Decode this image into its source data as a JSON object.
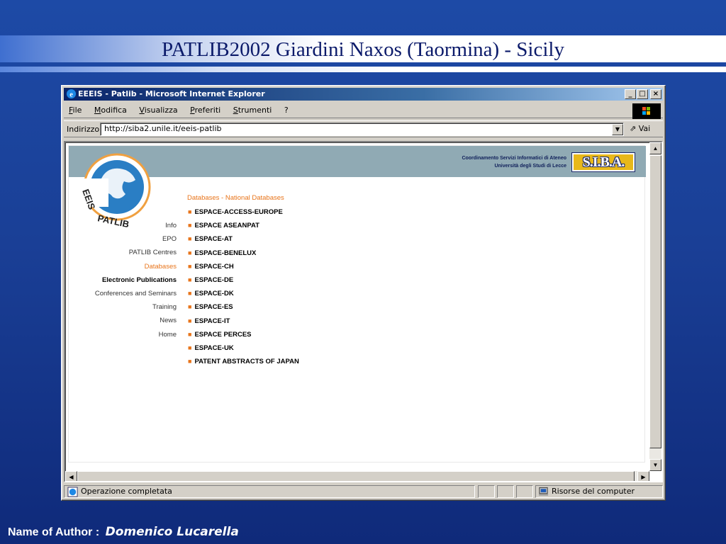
{
  "slide": {
    "title": "PATLIB2002 Giardini Naxos (Taormina) - Sicily",
    "author_label": "Name of Author :",
    "author_name": "Domenico Lucarella"
  },
  "browser": {
    "window_title": "EEEIS - Patlib - Microsoft Internet Explorer",
    "window_buttons": [
      "_",
      "□",
      "×"
    ],
    "menu": [
      "File",
      "Modifica",
      "Visualizza",
      "Preferiti",
      "Strumenti",
      "?"
    ],
    "address_label": "Indirizzo",
    "address_value": "http://siba2.unile.it/eeis-patlib",
    "go_label": "Vai",
    "status_text": "Operazione completata",
    "zone_text": "Risorse del computer"
  },
  "page": {
    "header_line1": "Coordinamento Servizi Informatici di Ateneo",
    "header_line2": "Università degli Studi di Lecce",
    "siba_logo_text": "S.I.B.A.",
    "logo_word1": "EEIS",
    "logo_word2": "PATLIB",
    "section_title": "Databases - National Databases",
    "nav_items": [
      "Info",
      "EPO",
      "PATLIB Centres",
      "Databases",
      "Electronic Publications",
      "Conferences and Seminars",
      "Training",
      "News",
      "Home"
    ],
    "databases": [
      "ESPACE-ACCESS-EUROPE",
      "ESPACE ASEANPAT",
      "ESPACE-AT",
      "ESPACE-BENELUX",
      "ESPACE-CH",
      "ESPACE-DE",
      "ESPACE-DK",
      "ESPACE-ES",
      "ESPACE-IT",
      "ESPACE PERCES",
      "ESPACE-UK",
      "PATENT ABSTRACTS OF JAPAN"
    ]
  },
  "colors": {
    "slide_background": "#1a3f96",
    "title_text": "#0b1a6a",
    "ie_titlebar": "#0a246a",
    "page_header": "#90aab4",
    "accent_orange": "#e8741a",
    "globe_blue": "#2a7ec4"
  }
}
